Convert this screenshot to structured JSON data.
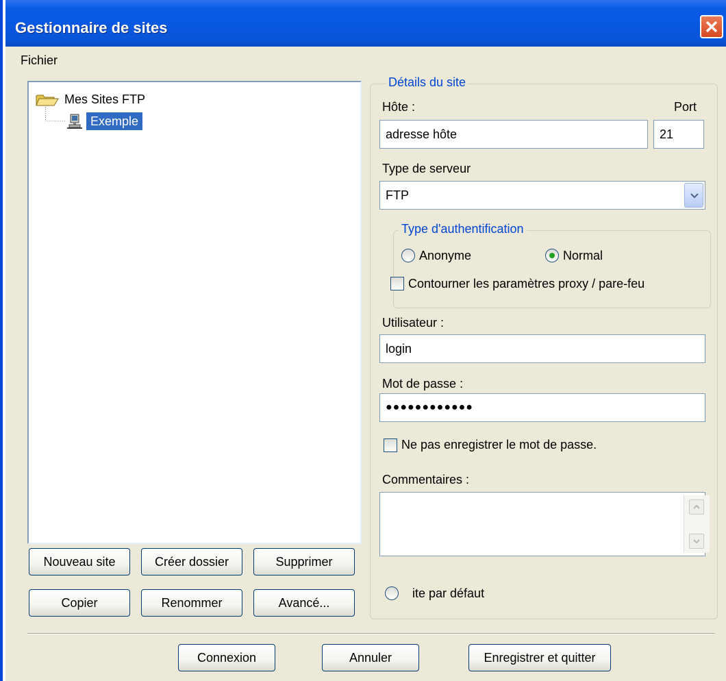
{
  "window": {
    "title": "Gestionnaire de sites",
    "close_icon": "close-icon"
  },
  "menu": {
    "file": "Fichier"
  },
  "tree": {
    "root_label": "Mes Sites FTP",
    "root_icon": "open-folder-icon",
    "child_label": "Exemple",
    "child_icon": "computer-icon"
  },
  "left_buttons": {
    "new_site": "Nouveau site",
    "new_folder": "Créer dossier",
    "delete": "Supprimer",
    "copy": "Copier",
    "rename": "Renommer",
    "advanced": "Avancé..."
  },
  "details": {
    "group_title": "Détails du site",
    "host_label": "Hôte :",
    "host_value": "adresse hôte",
    "port_label": "Port",
    "port_value": "21",
    "server_type_label": "Type de serveur",
    "server_type_value": "FTP",
    "auth_group_title": "Type d'authentification",
    "auth_anonymous": "Anonyme",
    "auth_normal": "Normal",
    "auth_selected": "Normal",
    "bypass_proxy_label": "Contourner les paramètres proxy / pare-feu",
    "bypass_proxy_checked": false,
    "user_label": "Utilisateur :",
    "user_value": "login",
    "password_label": "Mot de passe :",
    "password_value": "●●●●●●●●●●●●",
    "dont_save_password_label": "Ne pas enregistrer le mot de passe.",
    "dont_save_password_checked": false,
    "comments_label": "Commentaires :",
    "comments_value": "",
    "default_site_label": "ite par défaut",
    "default_site_checked": false
  },
  "bottom_buttons": {
    "connect": "Connexion",
    "cancel": "Annuler",
    "save_close": "Enregistrer et quitter"
  },
  "colors": {
    "titlebar": "#0757e0",
    "selection": "#316ac5",
    "group_title": "#0046d5",
    "dialog_bg": "#ece9d8"
  }
}
